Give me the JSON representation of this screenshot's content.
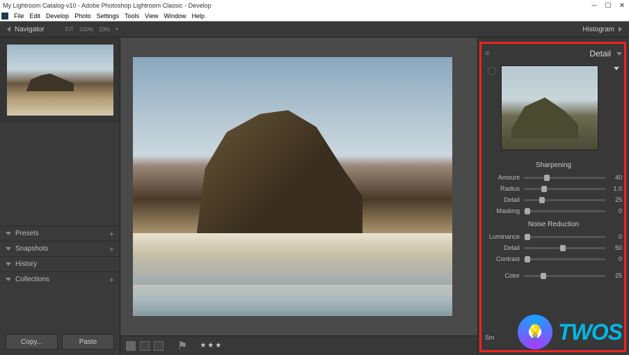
{
  "window": {
    "title": "My Lightroom Catalog-v10 - Adobe Photoshop Lightroom Classic - Develop"
  },
  "menu": {
    "items": [
      "File",
      "Edit",
      "Develop",
      "Photo",
      "Settings",
      "Tools",
      "View",
      "Window",
      "Help"
    ]
  },
  "left": {
    "navigator": "Navigator",
    "fit": "FIT",
    "zoom100": "100%",
    "zoom33": "33%",
    "panels": [
      {
        "label": "Presets",
        "plus": "+"
      },
      {
        "label": "Snapshots",
        "plus": "+"
      },
      {
        "label": "History",
        "plus": ""
      },
      {
        "label": "Collections",
        "plus": "+"
      }
    ],
    "copy_btn": "Copy...",
    "paste_btn": "Paste"
  },
  "top_right": {
    "histogram": "Histogram"
  },
  "bottom": {
    "stars": "★★★"
  },
  "detail": {
    "title": "Detail",
    "sharpening": {
      "title": "Sharpening",
      "sliders": [
        {
          "label": "Amount",
          "value": "40",
          "pos": 28
        },
        {
          "label": "Radius",
          "value": "1.0",
          "pos": 25
        },
        {
          "label": "Detail",
          "value": "25",
          "pos": 22
        },
        {
          "label": "Masking",
          "value": "0",
          "pos": 4
        }
      ]
    },
    "noise": {
      "title": "Noise Reduction",
      "sliders": [
        {
          "label": "Luminance",
          "value": "0",
          "pos": 4
        },
        {
          "label": "Detail",
          "value": "50",
          "pos": 48
        },
        {
          "label": "Contrast",
          "value": "0",
          "pos": 4
        }
      ]
    },
    "color": {
      "label": "Color",
      "value": "25",
      "pos": 24
    },
    "smooth": "Sm"
  },
  "watermark": {
    "text": "TWOS"
  }
}
